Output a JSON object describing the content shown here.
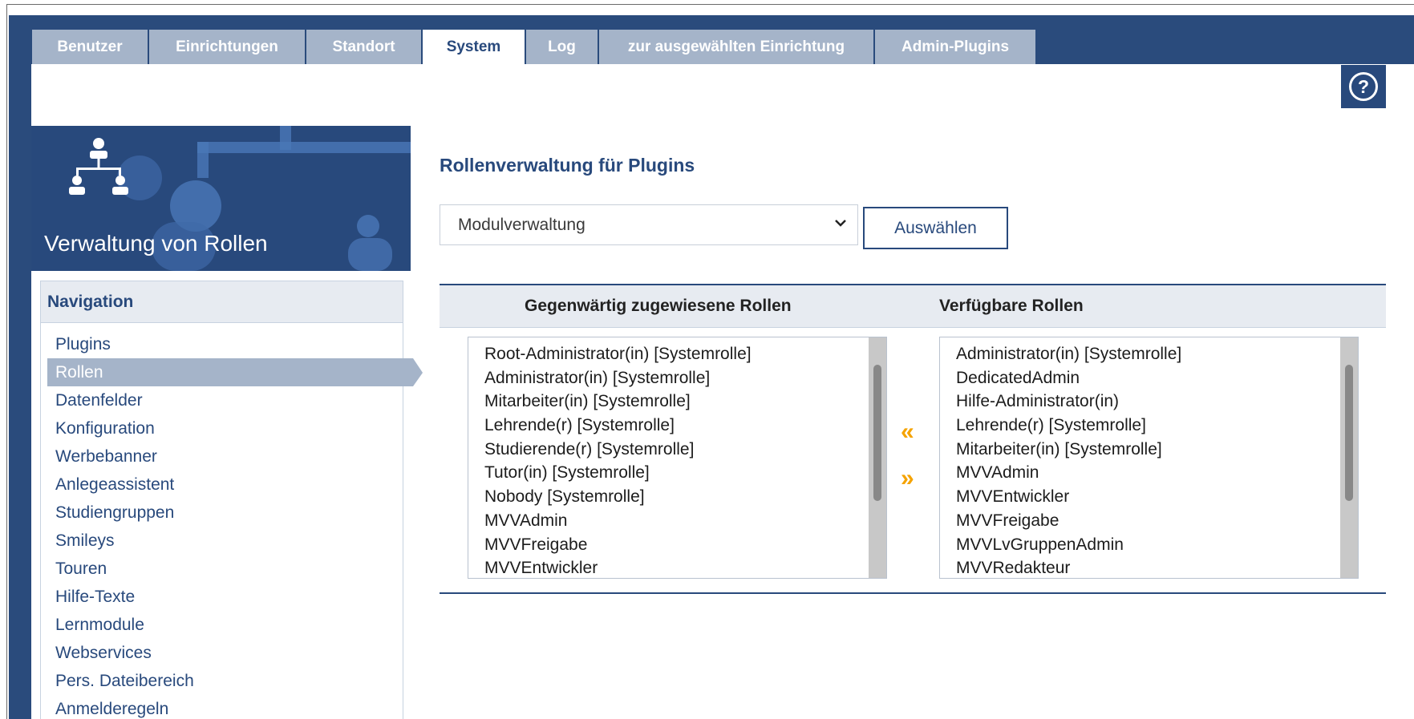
{
  "tabs": [
    {
      "label": "Benutzer",
      "active": false
    },
    {
      "label": "Einrichtungen",
      "active": false
    },
    {
      "label": "Standort",
      "active": false
    },
    {
      "label": "System",
      "active": true
    },
    {
      "label": "Log",
      "active": false
    },
    {
      "label": "zur ausgewählten Einrichtung",
      "active": false
    },
    {
      "label": "Admin-Plugins",
      "active": false
    }
  ],
  "help": {
    "icon": "help-circle-icon",
    "glyph": "?"
  },
  "sidebar": {
    "title": "Verwaltung von Rollen",
    "icon": "role-hierarchy-icon"
  },
  "nav": {
    "heading": "Navigation",
    "items": [
      {
        "label": "Plugins",
        "active": false
      },
      {
        "label": "Rollen",
        "active": true
      },
      {
        "label": "Datenfelder",
        "active": false
      },
      {
        "label": "Konfiguration",
        "active": false
      },
      {
        "label": "Werbebanner",
        "active": false
      },
      {
        "label": "Anlegeassistent",
        "active": false
      },
      {
        "label": "Studiengruppen",
        "active": false
      },
      {
        "label": "Smileys",
        "active": false
      },
      {
        "label": "Touren",
        "active": false
      },
      {
        "label": "Hilfe-Texte",
        "active": false
      },
      {
        "label": "Lernmodule",
        "active": false
      },
      {
        "label": "Webservices",
        "active": false
      },
      {
        "label": "Pers. Dateibereich",
        "active": false
      },
      {
        "label": "Anmelderegeln",
        "active": false
      }
    ]
  },
  "main": {
    "title": "Rollenverwaltung für Plugins",
    "plugin_select": {
      "value": "Modulverwaltung"
    },
    "select_button": "Auswählen",
    "assigned_header": "Gegenwärtig zugewiesene Rollen",
    "available_header": "Verfügbare Rollen",
    "assigned_roles": [
      "Root-Administrator(in) [Systemrolle]",
      "Administrator(in) [Systemrolle]",
      "Mitarbeiter(in) [Systemrolle]",
      "Lehrende(r) [Systemrolle]",
      "Studierende(r) [Systemrolle]",
      "Tutor(in) [Systemrolle]",
      "Nobody [Systemrolle]",
      "MVVAdmin",
      "MVVFreigabe",
      "MVVEntwickler"
    ],
    "available_roles": [
      "Administrator(in) [Systemrolle]",
      "DedicatedAdmin",
      "Hilfe-Administrator(in)",
      "Lehrende(r) [Systemrolle]",
      "Mitarbeiter(in) [Systemrolle]",
      "MVVAdmin",
      "MVVEntwickler",
      "MVVFreigabe",
      "MVVLvGruppenAdmin",
      "MVVRedakteur"
    ],
    "move_left_glyph": "«",
    "move_right_glyph": "»"
  },
  "colors": {
    "brand": "#28497c",
    "tab_inactive": "#a5b4c9",
    "accent_arrows": "#f5a300"
  }
}
